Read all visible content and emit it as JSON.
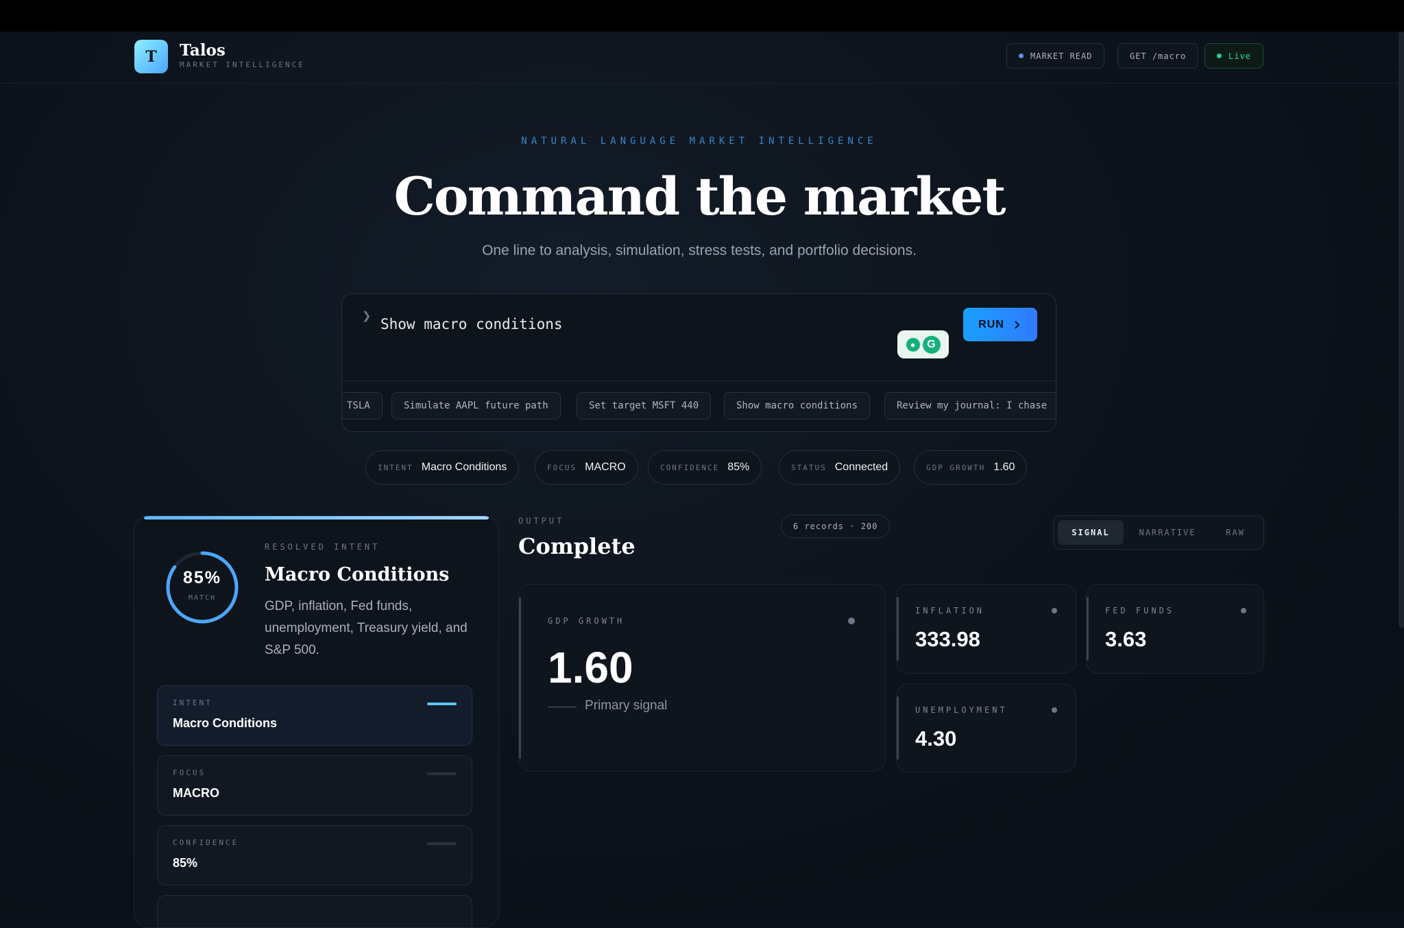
{
  "brand": {
    "logo_letter": "T",
    "name": "Talos",
    "tagline": "MARKET INTELLIGENCE"
  },
  "header_pills": [
    {
      "label": "MARKET READ",
      "dot_color": "#6c8bd8"
    },
    {
      "label": "GET /macro"
    },
    {
      "label": "Live",
      "dot_color": "#1fcf8f"
    }
  ],
  "hero": {
    "eyebrow": "NATURAL LANGUAGE MARKET INTELLIGENCE",
    "title": "Command the market",
    "subtitle": "One line to analysis, simulation, stress tests, and portfolio decisions."
  },
  "command": {
    "caret": "❯",
    "value": "Show macro conditions",
    "run_label": "RUN",
    "run_icon": "chevron-right-icon",
    "suggestions": [
      "TSLA",
      "Simulate AAPL future path",
      "Set target MSFT 440",
      "Show macro conditions",
      "Review my journal: I chase"
    ]
  },
  "status_pills": [
    {
      "key": "INTENT",
      "value": "Macro Conditions"
    },
    {
      "key": "FOCUS",
      "value": "MACRO"
    },
    {
      "key": "CONFIDENCE",
      "value": "85%"
    },
    {
      "key": "STATUS",
      "value": "Connected"
    },
    {
      "key": "GDP GROWTH",
      "value": "1.60"
    }
  ],
  "resolved": {
    "match_pct": "85%",
    "match_fraction": 0.85,
    "match_label": "MATCH",
    "label": "RESOLVED INTENT",
    "title": "Macro Conditions",
    "description": "GDP, inflation, Fed funds, unemployment, Treasury yield, and S&P 500.",
    "fields": [
      {
        "key": "INTENT",
        "value": "Macro Conditions",
        "active": true
      },
      {
        "key": "FOCUS",
        "value": "MACRO"
      },
      {
        "key": "CONFIDENCE",
        "value": "85%"
      }
    ]
  },
  "output": {
    "label": "OUTPUT",
    "title": "Complete",
    "records": "6 records · 200",
    "tabs": [
      "SIGNAL",
      "NARRATIVE",
      "RAW"
    ],
    "active_tab": "SIGNAL",
    "primary": {
      "key": "GDP GROWTH",
      "value": "1.60",
      "note": "Primary signal"
    },
    "metrics": [
      {
        "key": "INFLATION",
        "value": "333.98"
      },
      {
        "key": "FED FUNDS",
        "value": "3.63"
      },
      {
        "key": "UNEMPLOYMENT",
        "value": "4.30"
      }
    ]
  },
  "colors": {
    "accent": "#2f9bff",
    "background": "#0b1119",
    "live": "#1fcf8f"
  }
}
